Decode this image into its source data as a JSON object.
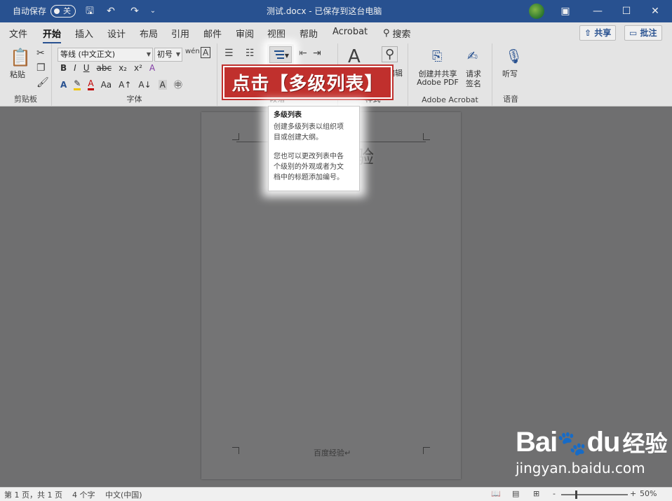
{
  "titlebar": {
    "autosave_label": "自动保存",
    "autosave_toggle": "关",
    "doc_title": "测试.docx - 已保存到这台电脑",
    "minimize": "—",
    "restore": "❐",
    "maximize": "☐",
    "close": "✕"
  },
  "tabs": {
    "items": [
      "文件",
      "开始",
      "插入",
      "设计",
      "布局",
      "引用",
      "邮件",
      "审阅",
      "视图",
      "帮助",
      "Acrobat"
    ],
    "active": "开始",
    "search_label": "搜索",
    "share_label": "共享",
    "comment_label": "批注"
  },
  "ribbon": {
    "clipboard": {
      "paste_label": "粘贴",
      "group_label": "剪贴板"
    },
    "font": {
      "font_name": "等线 (中文正文)",
      "font_size": "初号",
      "group_label": "字体",
      "bold": "B",
      "italic": "I",
      "underline": "U",
      "strike": "abc",
      "sub": "x₂",
      "sup": "x²",
      "case": "Aa"
    },
    "paragraph": {
      "group_label": "段落"
    },
    "styles": {
      "group_label": "样式",
      "edit_label": "编辑"
    },
    "acrobat": {
      "create_share_label": "创建并共享",
      "adobe_pdf_label": "Adobe PDF",
      "request_label": "请求",
      "sign_label": "签名",
      "group_label": "Adobe Acrobat"
    },
    "voice": {
      "dictate_label": "听写",
      "group_label": "语音"
    }
  },
  "tooltip": {
    "title": "多级列表",
    "line1": "创建多级列表以组织项",
    "line2": "目或创建大纲。",
    "line3": "您也可以更改列表中各",
    "line4": "个级别的外观或者为文",
    "line5": "档中的标题添加编号。"
  },
  "callout": {
    "text": "点击【多级列表】"
  },
  "page": {
    "big_char": "验",
    "footer": "百度经验↵"
  },
  "statusbar": {
    "page_info": "第 1 页，共 1 页",
    "word_count": "4 个字",
    "language": "中文(中国)",
    "zoom_minus": "-",
    "zoom_plus": "+",
    "zoom": "50%"
  },
  "watermark": {
    "brand": "Bai",
    "brand2": "du",
    "cn": "经验",
    "url": "jingyan.baidu.com"
  }
}
